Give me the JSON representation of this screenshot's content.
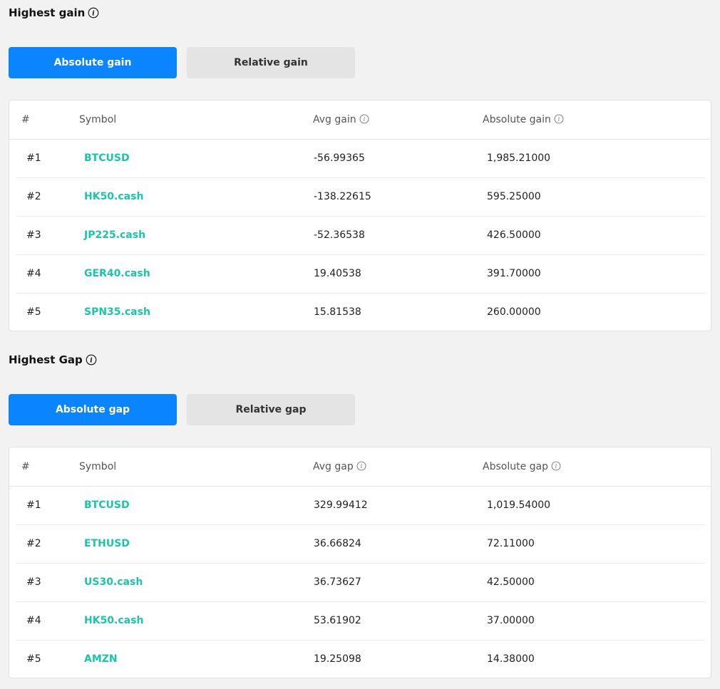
{
  "gain": {
    "title": "Highest gain",
    "tabs": {
      "active": "Absolute gain",
      "inactive": "Relative gain"
    },
    "headers": [
      "#",
      "Symbol",
      "Avg gain",
      "Absolute gain"
    ],
    "rows": [
      {
        "rank": "#1",
        "symbol": "BTCUSD",
        "avg": "-56.99365",
        "abs": "1,985.21000"
      },
      {
        "rank": "#2",
        "symbol": "HK50.cash",
        "avg": "-138.22615",
        "abs": "595.25000"
      },
      {
        "rank": "#3",
        "symbol": "JP225.cash",
        "avg": "-52.36538",
        "abs": "426.50000"
      },
      {
        "rank": "#4",
        "symbol": "GER40.cash",
        "avg": "19.40538",
        "abs": "391.70000"
      },
      {
        "rank": "#5",
        "symbol": "SPN35.cash",
        "avg": "15.81538",
        "abs": "260.00000"
      }
    ]
  },
  "gap": {
    "title": "Highest Gap",
    "tabs": {
      "active": "Absolute gap",
      "inactive": "Relative gap"
    },
    "headers": [
      "#",
      "Symbol",
      "Avg gap",
      "Absolute gap"
    ],
    "rows": [
      {
        "rank": "#1",
        "symbol": "BTCUSD",
        "avg": "329.99412",
        "abs": "1,019.54000"
      },
      {
        "rank": "#2",
        "symbol": "ETHUSD",
        "avg": "36.66824",
        "abs": "72.11000"
      },
      {
        "rank": "#3",
        "symbol": "US30.cash",
        "avg": "36.73627",
        "abs": "42.50000"
      },
      {
        "rank": "#4",
        "symbol": "HK50.cash",
        "avg": "53.61902",
        "abs": "37.00000"
      },
      {
        "rank": "#5",
        "symbol": "AMZN",
        "avg": "19.25098",
        "abs": "14.38000"
      }
    ]
  },
  "colors": {
    "accent": "#0a84ff",
    "symbol": "#1cc4a8",
    "inactive_tab": "#e4e4e4",
    "background": "#f2f2f2"
  },
  "icons": {
    "info": "info-icon"
  }
}
